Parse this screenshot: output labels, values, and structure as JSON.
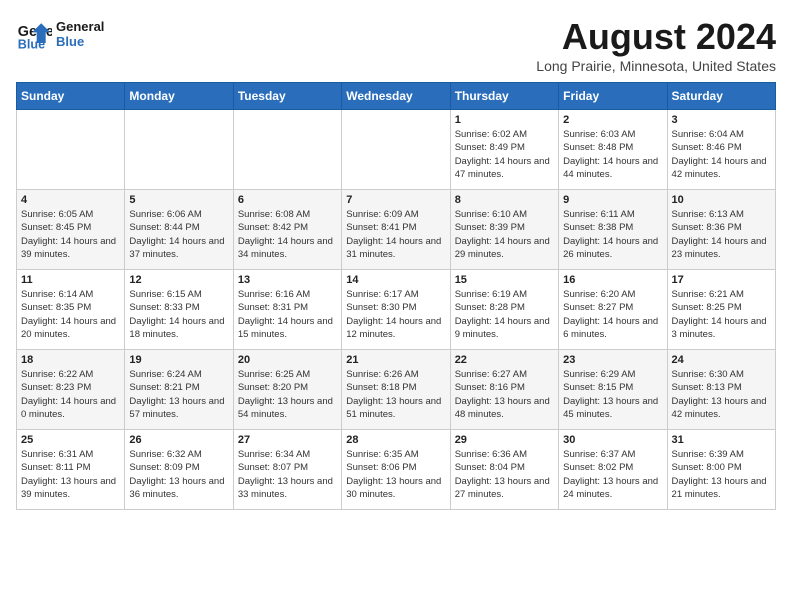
{
  "header": {
    "logo_line1": "General",
    "logo_line2": "Blue",
    "title": "August 2024",
    "subtitle": "Long Prairie, Minnesota, United States"
  },
  "weekdays": [
    "Sunday",
    "Monday",
    "Tuesday",
    "Wednesday",
    "Thursday",
    "Friday",
    "Saturday"
  ],
  "weeks": [
    [
      {
        "day": "",
        "info": ""
      },
      {
        "day": "",
        "info": ""
      },
      {
        "day": "",
        "info": ""
      },
      {
        "day": "",
        "info": ""
      },
      {
        "day": "1",
        "info": "Sunrise: 6:02 AM\nSunset: 8:49 PM\nDaylight: 14 hours and 47 minutes."
      },
      {
        "day": "2",
        "info": "Sunrise: 6:03 AM\nSunset: 8:48 PM\nDaylight: 14 hours and 44 minutes."
      },
      {
        "day": "3",
        "info": "Sunrise: 6:04 AM\nSunset: 8:46 PM\nDaylight: 14 hours and 42 minutes."
      }
    ],
    [
      {
        "day": "4",
        "info": "Sunrise: 6:05 AM\nSunset: 8:45 PM\nDaylight: 14 hours and 39 minutes."
      },
      {
        "day": "5",
        "info": "Sunrise: 6:06 AM\nSunset: 8:44 PM\nDaylight: 14 hours and 37 minutes."
      },
      {
        "day": "6",
        "info": "Sunrise: 6:08 AM\nSunset: 8:42 PM\nDaylight: 14 hours and 34 minutes."
      },
      {
        "day": "7",
        "info": "Sunrise: 6:09 AM\nSunset: 8:41 PM\nDaylight: 14 hours and 31 minutes."
      },
      {
        "day": "8",
        "info": "Sunrise: 6:10 AM\nSunset: 8:39 PM\nDaylight: 14 hours and 29 minutes."
      },
      {
        "day": "9",
        "info": "Sunrise: 6:11 AM\nSunset: 8:38 PM\nDaylight: 14 hours and 26 minutes."
      },
      {
        "day": "10",
        "info": "Sunrise: 6:13 AM\nSunset: 8:36 PM\nDaylight: 14 hours and 23 minutes."
      }
    ],
    [
      {
        "day": "11",
        "info": "Sunrise: 6:14 AM\nSunset: 8:35 PM\nDaylight: 14 hours and 20 minutes."
      },
      {
        "day": "12",
        "info": "Sunrise: 6:15 AM\nSunset: 8:33 PM\nDaylight: 14 hours and 18 minutes."
      },
      {
        "day": "13",
        "info": "Sunrise: 6:16 AM\nSunset: 8:31 PM\nDaylight: 14 hours and 15 minutes."
      },
      {
        "day": "14",
        "info": "Sunrise: 6:17 AM\nSunset: 8:30 PM\nDaylight: 14 hours and 12 minutes."
      },
      {
        "day": "15",
        "info": "Sunrise: 6:19 AM\nSunset: 8:28 PM\nDaylight: 14 hours and 9 minutes."
      },
      {
        "day": "16",
        "info": "Sunrise: 6:20 AM\nSunset: 8:27 PM\nDaylight: 14 hours and 6 minutes."
      },
      {
        "day": "17",
        "info": "Sunrise: 6:21 AM\nSunset: 8:25 PM\nDaylight: 14 hours and 3 minutes."
      }
    ],
    [
      {
        "day": "18",
        "info": "Sunrise: 6:22 AM\nSunset: 8:23 PM\nDaylight: 14 hours and 0 minutes."
      },
      {
        "day": "19",
        "info": "Sunrise: 6:24 AM\nSunset: 8:21 PM\nDaylight: 13 hours and 57 minutes."
      },
      {
        "day": "20",
        "info": "Sunrise: 6:25 AM\nSunset: 8:20 PM\nDaylight: 13 hours and 54 minutes."
      },
      {
        "day": "21",
        "info": "Sunrise: 6:26 AM\nSunset: 8:18 PM\nDaylight: 13 hours and 51 minutes."
      },
      {
        "day": "22",
        "info": "Sunrise: 6:27 AM\nSunset: 8:16 PM\nDaylight: 13 hours and 48 minutes."
      },
      {
        "day": "23",
        "info": "Sunrise: 6:29 AM\nSunset: 8:15 PM\nDaylight: 13 hours and 45 minutes."
      },
      {
        "day": "24",
        "info": "Sunrise: 6:30 AM\nSunset: 8:13 PM\nDaylight: 13 hours and 42 minutes."
      }
    ],
    [
      {
        "day": "25",
        "info": "Sunrise: 6:31 AM\nSunset: 8:11 PM\nDaylight: 13 hours and 39 minutes."
      },
      {
        "day": "26",
        "info": "Sunrise: 6:32 AM\nSunset: 8:09 PM\nDaylight: 13 hours and 36 minutes."
      },
      {
        "day": "27",
        "info": "Sunrise: 6:34 AM\nSunset: 8:07 PM\nDaylight: 13 hours and 33 minutes."
      },
      {
        "day": "28",
        "info": "Sunrise: 6:35 AM\nSunset: 8:06 PM\nDaylight: 13 hours and 30 minutes."
      },
      {
        "day": "29",
        "info": "Sunrise: 6:36 AM\nSunset: 8:04 PM\nDaylight: 13 hours and 27 minutes."
      },
      {
        "day": "30",
        "info": "Sunrise: 6:37 AM\nSunset: 8:02 PM\nDaylight: 13 hours and 24 minutes."
      },
      {
        "day": "31",
        "info": "Sunrise: 6:39 AM\nSunset: 8:00 PM\nDaylight: 13 hours and 21 minutes."
      }
    ]
  ]
}
